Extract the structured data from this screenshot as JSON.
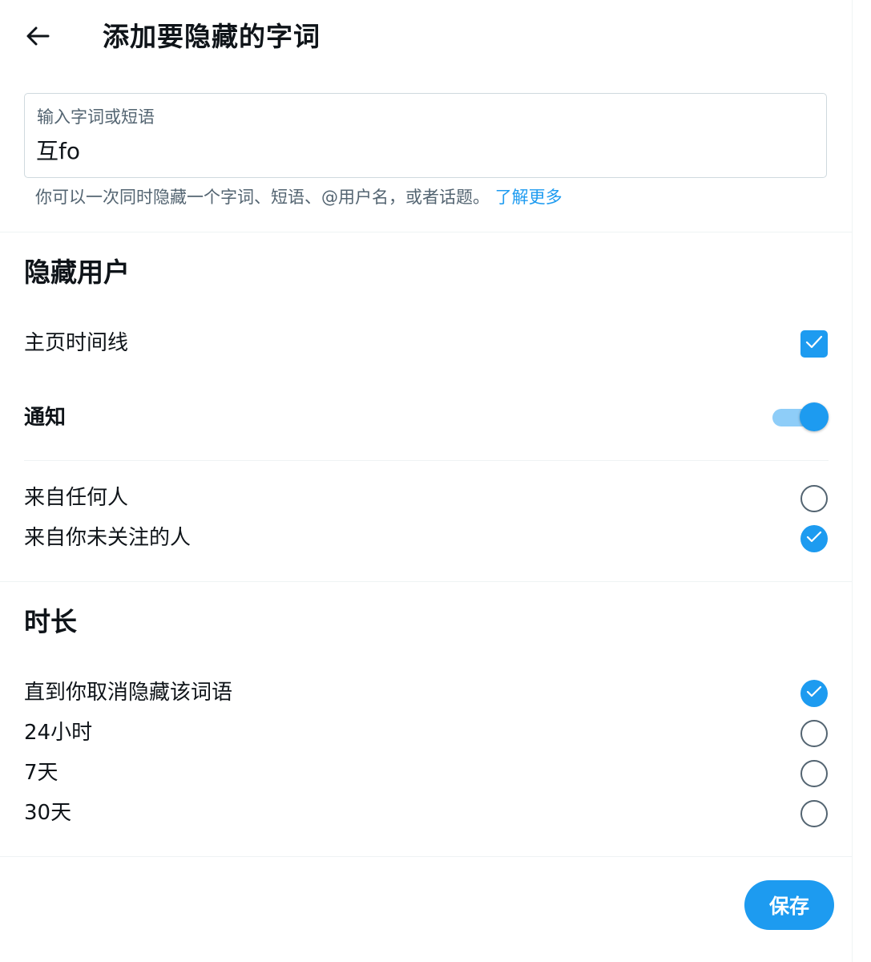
{
  "header": {
    "title": "添加要隐藏的字词"
  },
  "input": {
    "label": "输入字词或短语",
    "value": "互fo"
  },
  "hint": {
    "text": "你可以一次同时隐藏一个字词、短语、@用户名，或者话题。",
    "link": "了解更多"
  },
  "mute_from": {
    "title": "隐藏用户",
    "home_timeline": {
      "label": "主页时间线",
      "checked": true
    },
    "notifications": {
      "label": "通知",
      "enabled": true
    },
    "options": [
      {
        "label": "来自任何人",
        "selected": false
      },
      {
        "label": "来自你未关注的人",
        "selected": true
      }
    ]
  },
  "duration": {
    "title": "时长",
    "options": [
      {
        "label": "直到你取消隐藏该词语",
        "selected": true
      },
      {
        "label": "24小时",
        "selected": false
      },
      {
        "label": "7天",
        "selected": false
      },
      {
        "label": "30天",
        "selected": false
      }
    ]
  },
  "footer": {
    "save_label": "保存"
  },
  "colors": {
    "accent": "#1d9bf0",
    "toggle_track": "#8ecdf8",
    "secondary_text": "#536471",
    "border": "#cfd9de"
  }
}
